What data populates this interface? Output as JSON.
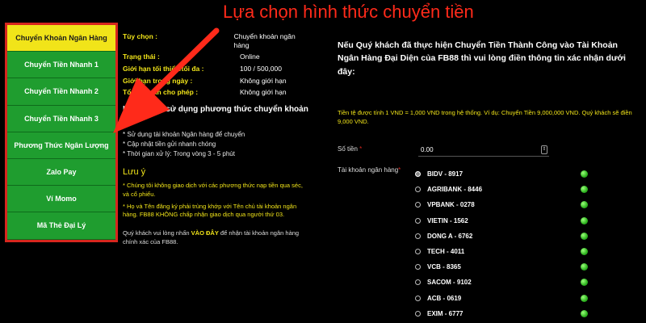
{
  "annotation": {
    "text": "Lựa chọn hình thức chuyển tiền",
    "color": "#ff2a1a"
  },
  "sidebar": {
    "items": [
      {
        "label": "Chuyển Khoản Ngân Hàng",
        "active": true
      },
      {
        "label": "Chuyển Tiền Nhanh 1",
        "active": false
      },
      {
        "label": "Chuyển Tiền Nhanh 2",
        "active": false
      },
      {
        "label": "Chuyển Tiền Nhanh 3",
        "active": false
      },
      {
        "label": "Phương Thức Ngân Lượng",
        "active": false
      },
      {
        "label": "Zalo Pay",
        "active": false
      },
      {
        "label": "Ví Momo",
        "active": false
      },
      {
        "label": "Mã Thẻ Đại Lý",
        "active": false
      }
    ],
    "active_color": "#f1e419",
    "item_color": "#1f9d2f",
    "border_color": "#d7261e"
  },
  "info": {
    "rows": [
      {
        "label": "Tùy chọn :",
        "value": "Chuyển khoản ngân hàng"
      },
      {
        "label": "Trạng thái :",
        "value": "Online"
      },
      {
        "label": "Giới hạn tối thiểu/tối đa :",
        "value": "100 / 500,000"
      },
      {
        "label": "Giới hạn trong ngày :",
        "value": "Không giới hạn"
      },
      {
        "label": "Tổng số lần cho phép :",
        "value": "Không giới hạn"
      }
    ],
    "benefits_title": "Lợi ích khi sử dụng phương thức chuyển khoản này",
    "benefits": [
      "* Sử dụng tài khoản Ngân hàng để chuyển",
      "* Cập nhật tiền gửi nhanh chóng",
      "* Thời gian xử lý: Trong vòng 3 - 5 phút"
    ],
    "note_title": "Lưu ý",
    "notes": [
      "* Chúng tôi không giao dịch với các phương thức nạp tiền qua séc, và cổ phiếu.",
      "* Họ và Tên đăng ký phải trùng khớp với Tên chủ tài khoản ngân hàng. FB88 KHÔNG chấp nhận giao dịch qua người thứ 03."
    ],
    "footer_pre": "Quý khách vui lòng nhấn",
    "footer_link": "VÀO ĐÂY",
    "footer_post": "để nhận tài khoản ngân hàng chính xác của FB88."
  },
  "form": {
    "intro": "Nếu Quý khách đã thực hiện Chuyển Tiền Thành Công vào Tài Khoản Ngân Hàng Đại Diện của FB88 thì vui lòng điền thông tin xác nhận dưới đây:",
    "rate_note": "Tiền tệ được tính 1 VND = 1,000 VND trong hệ thống. Ví dụ: Chuyển Tiền 9,000,000 VND. Quý khách sẽ điền 9,000 VND.",
    "amount_label": "Số tiền",
    "amount_value": "0.00",
    "bank_label": "Tài khoản ngân hàng",
    "required_mark": "*",
    "banks": [
      {
        "name": "BIDV - 8917",
        "selected": true
      },
      {
        "name": "AGRIBANK - 8446",
        "selected": false
      },
      {
        "name": "VPBANK - 0278",
        "selected": false
      },
      {
        "name": "VIETIN - 1562",
        "selected": false
      },
      {
        "name": "DONG A - 6762",
        "selected": false
      },
      {
        "name": "TECH - 4011",
        "selected": false
      },
      {
        "name": "VCB - 8365",
        "selected": false
      },
      {
        "name": "SACOM - 9102",
        "selected": false
      },
      {
        "name": "ACB - 0619",
        "selected": false
      },
      {
        "name": "EXIM - 6777",
        "selected": false
      }
    ],
    "status_icon": "green-status-dot-icon"
  }
}
